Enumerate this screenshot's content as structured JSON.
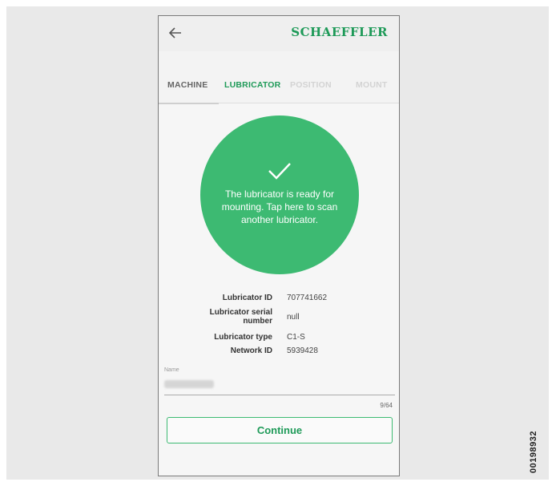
{
  "app": {
    "brand": "SCHAEFFLER",
    "back_icon": "arrow-left-icon"
  },
  "tabs": [
    {
      "label": "MACHINE",
      "state": "completed"
    },
    {
      "label": "LUBRICATOR",
      "state": "active"
    },
    {
      "label": "POSITION",
      "state": "disabled"
    },
    {
      "label": "MOUNT",
      "state": "disabled"
    }
  ],
  "status": {
    "icon": "check-icon",
    "message": "The lubricator is ready for mounting. Tap here to scan another lubricator.",
    "color": "#3dba72"
  },
  "details": [
    {
      "label": "Lubricator ID",
      "value": "707741662"
    },
    {
      "label": "Lubricator serial number",
      "value": "null"
    },
    {
      "label": "Lubricator type",
      "value": "C1-S"
    },
    {
      "label": "Network ID",
      "value": "5939428"
    }
  ],
  "name_field": {
    "label": "Name",
    "counter": "9/64"
  },
  "continue_label": "Continue",
  "document_id": "00198932",
  "colors": {
    "brand_green": "#1e9a58",
    "accent_green": "#3dba72"
  }
}
